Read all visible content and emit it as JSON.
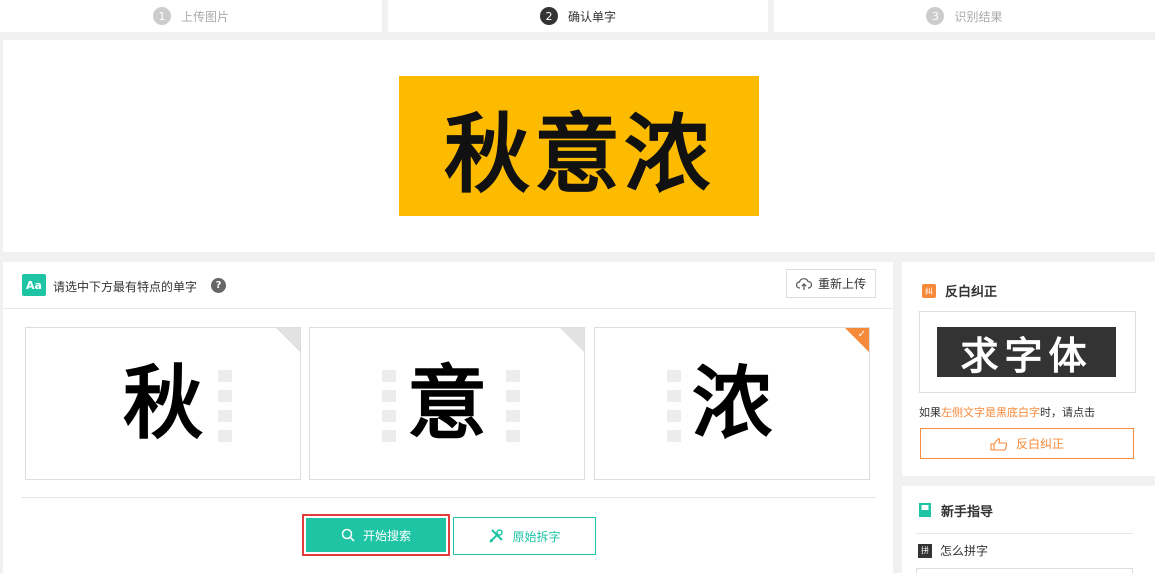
{
  "steps": [
    {
      "num": "1",
      "label": "上传图片"
    },
    {
      "num": "2",
      "label": "确认单字"
    },
    {
      "num": "3",
      "label": "识别结果"
    }
  ],
  "preview": {
    "text": "秋意浓"
  },
  "main": {
    "icon_text": "Aa",
    "title": "请选中下方最有特点的单字",
    "help": "?",
    "reupload_label": "重新上传",
    "chars": [
      "秋",
      "意",
      "浓"
    ],
    "selected_index": 2,
    "search_label": "开始搜索",
    "raw_label": "原始拆字"
  },
  "sidebar": {
    "invert": {
      "icon_text": "纠",
      "title": "反白纠正",
      "sample_text": "求字体",
      "desc_pre": "如果",
      "desc_hl": "左侧文字是黑底白字",
      "desc_post": "时，请点击",
      "button_label": "反白纠正"
    },
    "guide": {
      "title": "新手指导",
      "item_icon": "拼",
      "item_label": "怎么拼字"
    }
  },
  "colors": {
    "accent": "#1ec4a4",
    "orange": "#f7893b",
    "highlight_border": "#e23d3d",
    "preview_bg": "#fdbb00"
  }
}
